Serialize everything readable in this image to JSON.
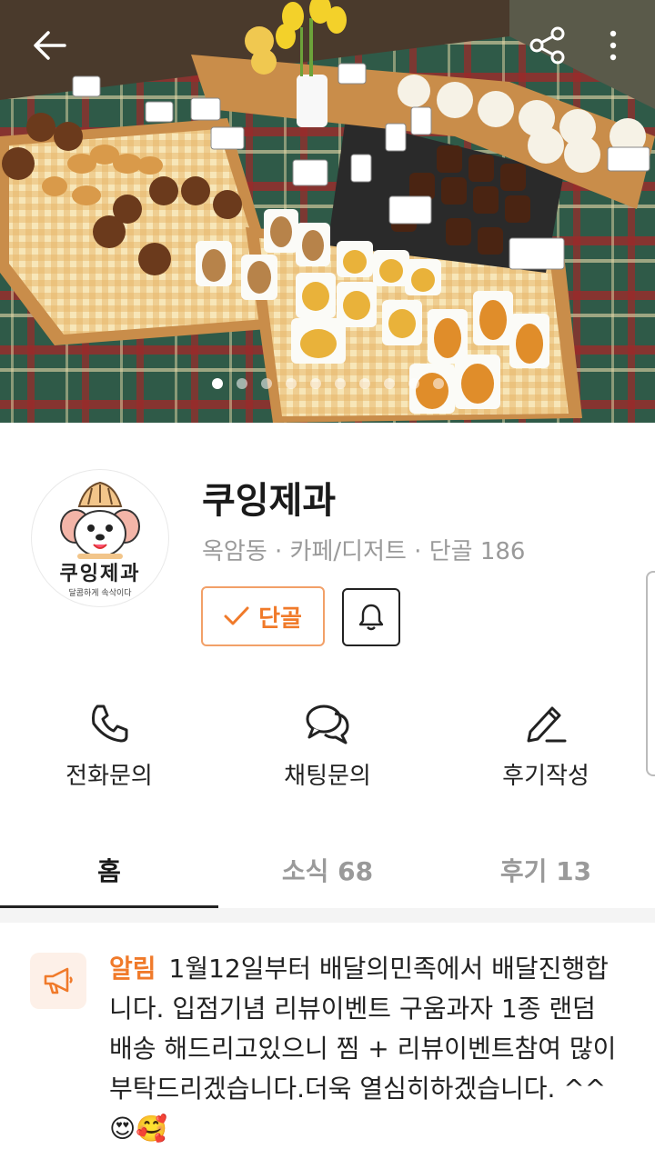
{
  "header": {
    "back_icon": "back-arrow-icon",
    "share_icon": "share-icon",
    "more_icon": "more-vertical-icon",
    "slides_total": 10,
    "slide_active": 1
  },
  "shop": {
    "name": "쿠잉제과",
    "meta": "옥암동 · 카페/디저트 · 단골 186",
    "logo_text": "쿠잉제과",
    "logo_subtext": "달콤하게 속삭이다",
    "regular_label": "단골",
    "bell_icon": "bell-icon"
  },
  "actions": [
    {
      "label": "전화문의",
      "icon": "phone-icon"
    },
    {
      "label": "채팅문의",
      "icon": "chat-icon"
    },
    {
      "label": "후기작성",
      "icon": "pencil-icon"
    }
  ],
  "tabs": [
    {
      "label": "홈",
      "active": true
    },
    {
      "label": "소식 68",
      "active": false
    },
    {
      "label": "후기 13",
      "active": false
    }
  ],
  "notice": {
    "tag": "알림",
    "text": "1월12일부터 배달의민족에서 배달진행합니다. 입점기념 리뷰이벤트 구움과자 1종 랜덤 배송 해드리고있으니 찜 + 리뷰이벤트참여 많이부탁드리겠습니다.더욱 열심히하겠습니다. ^^😍🥰",
    "icon": "megaphone-icon"
  },
  "colors": {
    "accent": "#f07a2a",
    "accent_border": "#f2a068",
    "muted": "#9a9a9a"
  }
}
